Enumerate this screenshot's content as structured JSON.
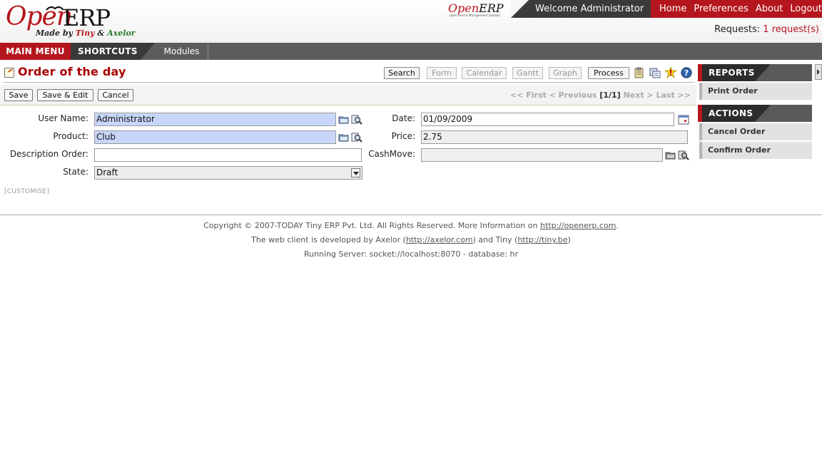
{
  "header": {
    "logo_open": "Open",
    "logo_erp": "ERP",
    "logo_tagline_prefix": "Made by",
    "logo_tagline_tiny": "Tiny",
    "logo_tagline_amp": "&",
    "logo_tagline_axelor": "Axelor",
    "mini_logo_open": "Open",
    "mini_logo_erp": "ERP",
    "mini_logo_sub": "Open Source Management Solution",
    "welcome": "Welcome Administrator",
    "links": [
      "Home",
      "Preferences",
      "About",
      "Logout"
    ],
    "requests_label": "Requests:",
    "requests_link": "1 request(s)"
  },
  "menubar": {
    "main_menu": "MAIN MENU",
    "shortcuts": "SHORTCUTS",
    "modules": "Modules"
  },
  "page": {
    "title": "Order of the day",
    "view_buttons": {
      "search": "Search",
      "form": "Form",
      "calendar": "Calendar",
      "gantt": "Gantt",
      "graph": "Graph",
      "process": "Process"
    }
  },
  "toolbar": {
    "save": "Save",
    "save_edit": "Save & Edit",
    "cancel": "Cancel",
    "pager_first": "<< First",
    "pager_prev": "< Previous",
    "pager_count": "[1/1]",
    "pager_next": "Next >",
    "pager_last": "Last >>"
  },
  "form": {
    "user_name_label": "User Name:",
    "user_name_value": "Administrator",
    "product_label": "Product:",
    "product_value": "Club",
    "description_label": "Description Order:",
    "description_value": "",
    "state_label": "State:",
    "state_value": "Draft",
    "date_label": "Date:",
    "date_value": "01/09/2009",
    "price_label": "Price:",
    "price_value": "2.75",
    "cashmove_label": "CashMove:",
    "cashmove_value": "",
    "customise": "[CUSTOMISE]"
  },
  "footer": {
    "line1_text": "Copyright © 2007-TODAY Tiny ERP Pvt. Ltd. All Rights Reserved. More Information on",
    "line1_link": "http://openerp.com",
    "line2_prefix": "The web client is developed by Axelor (",
    "line2_link1": "http://axelor.com",
    "line2_mid": ") and Tiny (",
    "line2_link2": "http://tiny.be",
    "line2_suffix": ")",
    "line3": "Running Server: socket://localhost:8070 - database: hr"
  },
  "sidebar": {
    "reports_title": "REPORTS",
    "reports_items": [
      "Print Order"
    ],
    "actions_title": "ACTIONS",
    "actions_items": [
      "Cancel Order",
      "Confirm Order"
    ]
  },
  "colors": {
    "brand_red": "#b5161d",
    "required_field": "#c8d6fa",
    "title_red": "#aa0000"
  },
  "icons": [
    "new-icon",
    "edit-icon",
    "help-icon",
    "calendar-icon",
    "folder-icon",
    "search-icon",
    "list-icon",
    "clipboard-icon"
  ]
}
